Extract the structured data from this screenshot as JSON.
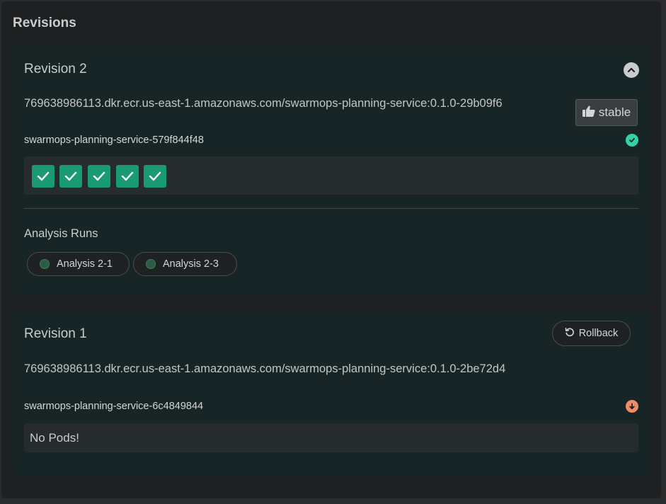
{
  "panel": {
    "title": "Revisions"
  },
  "revisions": [
    {
      "title": "Revision 2",
      "image": "769638986113.dkr.ecr.us-east-1.amazonaws.com/swarmops-planning-service:0.1.0-29b09f6",
      "badge_label": "stable",
      "replicaset": "swarmops-planning-service-579f844f48",
      "replicaset_status": "healthy",
      "pods": [
        "ok",
        "ok",
        "ok",
        "ok",
        "ok"
      ],
      "analysis_label": "Analysis Runs",
      "analysis_runs": [
        "Analysis 2-1",
        "Analysis 2-3"
      ]
    },
    {
      "title": "Revision 1",
      "image": "769638986113.dkr.ecr.us-east-1.amazonaws.com/swarmops-planning-service:0.1.0-2be72d4",
      "rollback_label": "Rollback",
      "replicaset": "swarmops-planning-service-6c4849844",
      "replicaset_status": "scaled-down",
      "empty_pods_text": "No Pods!"
    }
  ],
  "colors": {
    "pod_ok": "#1a9a72",
    "status_healthy": "#2fd3a5",
    "status_scaled_down": "#f08a6a"
  },
  "icons": {
    "collapse": "chevron-up-icon",
    "stable": "thumbs-up-icon",
    "rollback": "undo-icon",
    "healthy": "check-circle-icon",
    "scaled_down": "arrow-down-circle-icon",
    "pod": "check-icon"
  }
}
